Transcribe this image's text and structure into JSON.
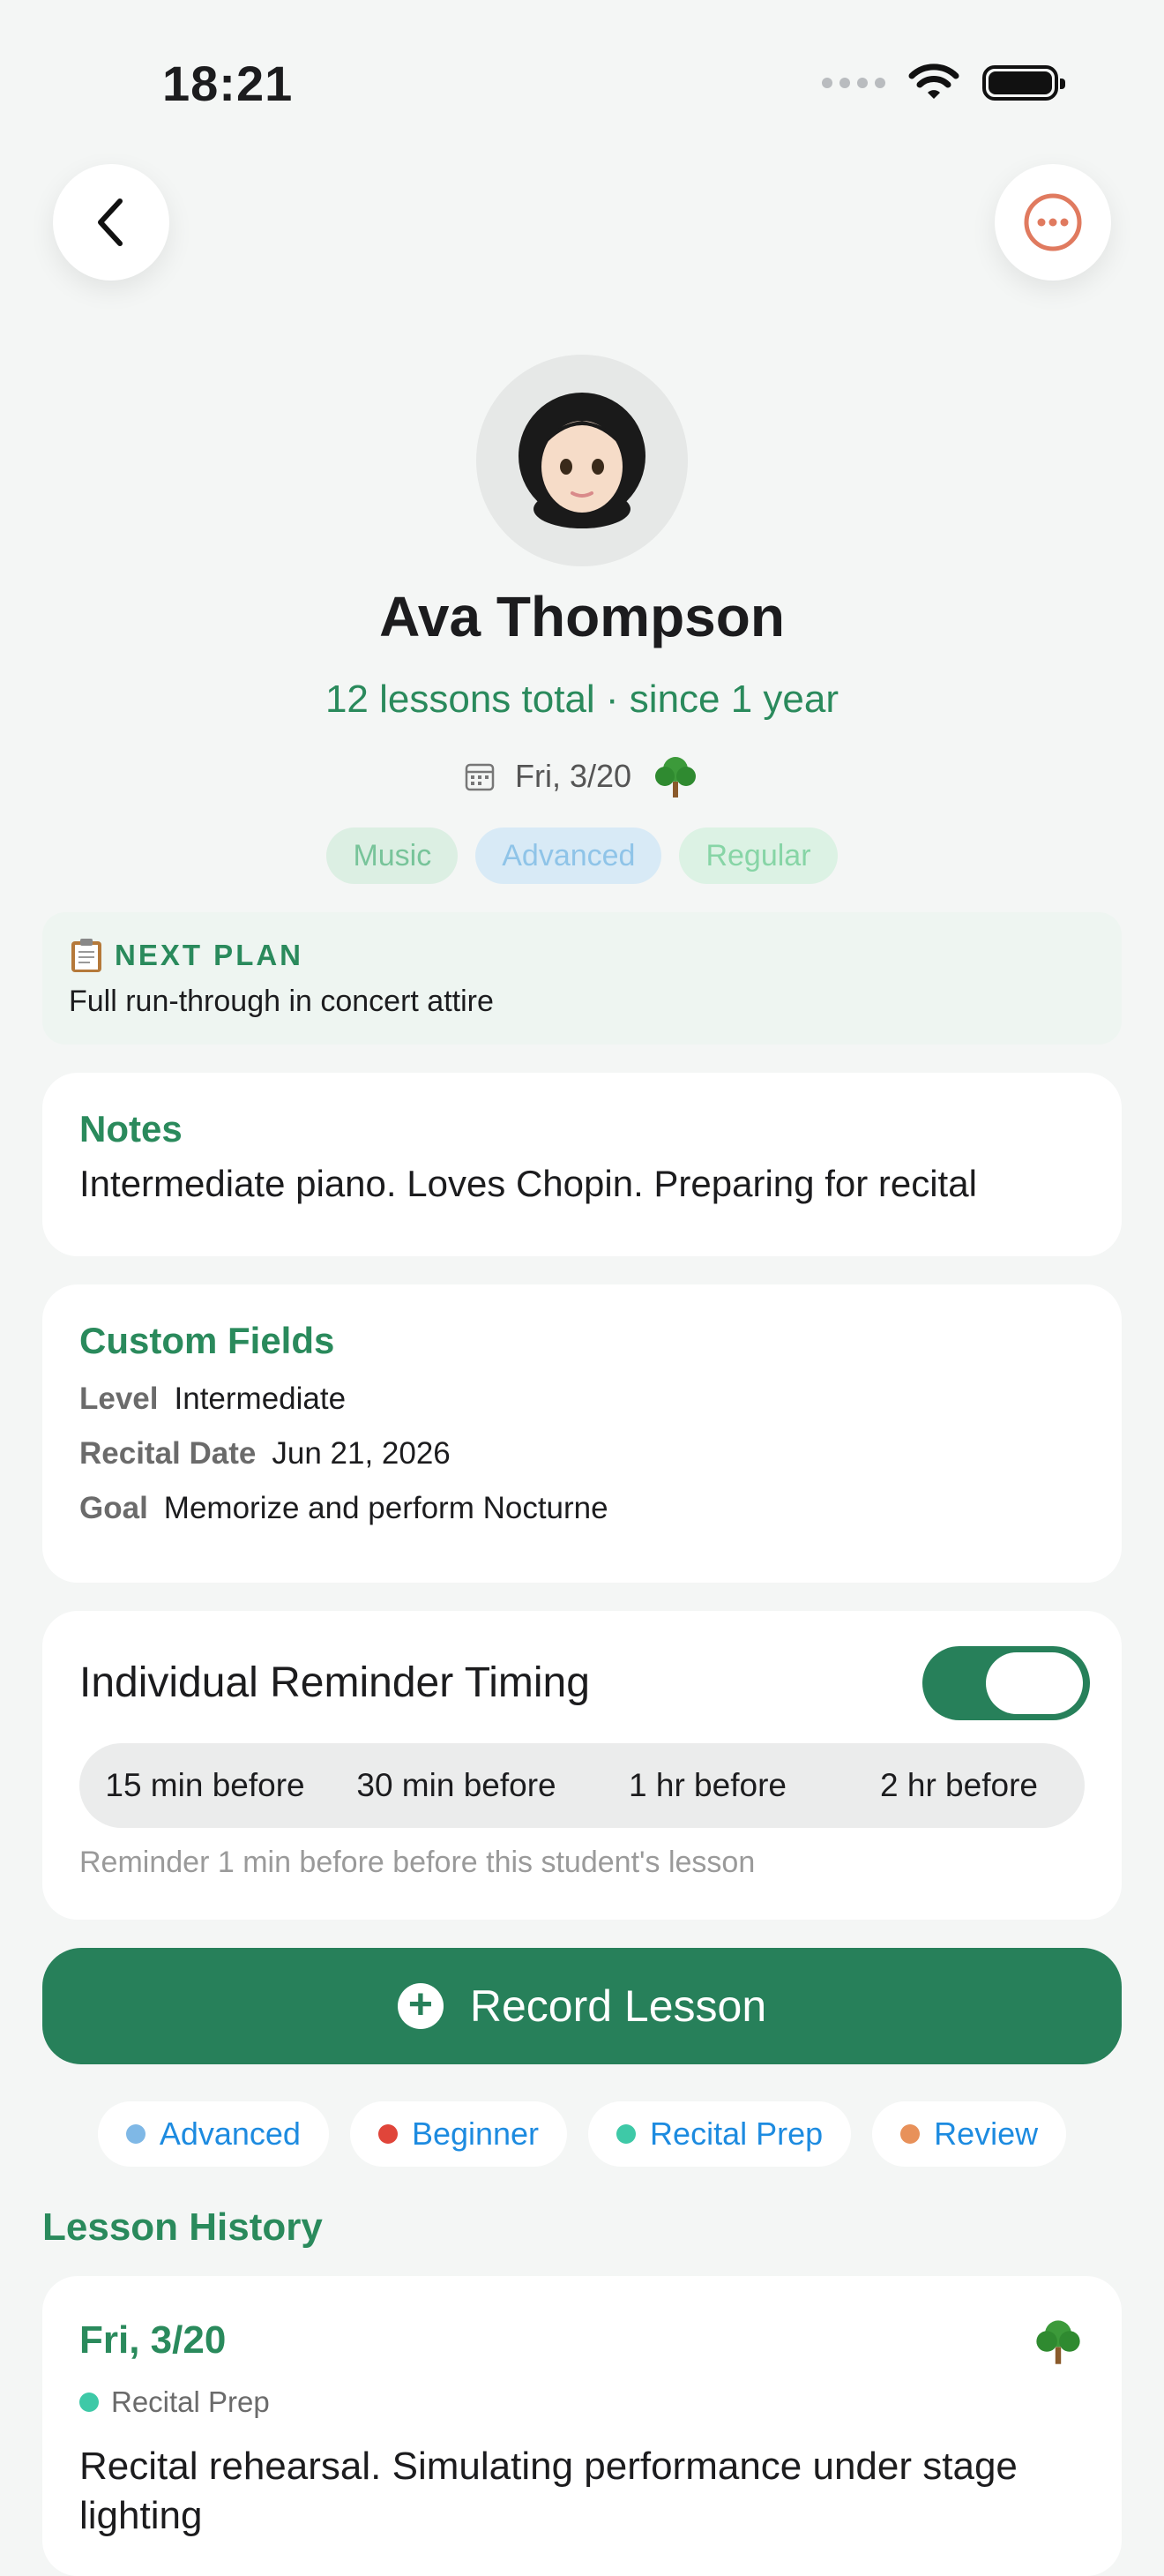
{
  "status_bar": {
    "time": "18:21"
  },
  "profile": {
    "name": "Ava Thompson",
    "subtitle": "12 lessons total · since 1 year",
    "date": "Fri, 3/20",
    "tags": [
      "Music",
      "Advanced",
      "Regular"
    ]
  },
  "next_plan": {
    "label": "NEXT PLAN",
    "text": "Full run-through in concert attire"
  },
  "notes": {
    "title": "Notes",
    "text": "Intermediate piano. Loves Chopin. Preparing for recital"
  },
  "custom_fields": {
    "title": "Custom Fields",
    "items": [
      {
        "key": "Level",
        "value": "Intermediate"
      },
      {
        "key": "Recital Date",
        "value": "Jun 21, 2026"
      },
      {
        "key": "Goal",
        "value": "Memorize and perform Nocturne"
      }
    ]
  },
  "reminder": {
    "title": "Individual Reminder Timing",
    "enabled": true,
    "options": [
      "15 min before",
      "30 min before",
      "1 hr before",
      "2 hr before"
    ],
    "hint": "Reminder 1 min before before this student's lesson"
  },
  "record_button": {
    "label": "Record Lesson"
  },
  "filters": [
    {
      "label": "Advanced",
      "color": "#7fb8e6"
    },
    {
      "label": "Beginner",
      "color": "#e0453a"
    },
    {
      "label": "Recital Prep",
      "color": "#3ec9a7"
    },
    {
      "label": "Review",
      "color": "#e8915a"
    }
  ],
  "history": {
    "title": "Lesson History",
    "entries": [
      {
        "date": "Fri, 3/20",
        "tag": "Recital Prep",
        "tag_color": "#3ec9a7",
        "text": "Recital rehearsal. Simulating performance under stage lighting"
      }
    ]
  },
  "colors": {
    "accent": "#27805a",
    "accent_text": "#2a8a5c",
    "more_icon": "#e07a5f"
  }
}
